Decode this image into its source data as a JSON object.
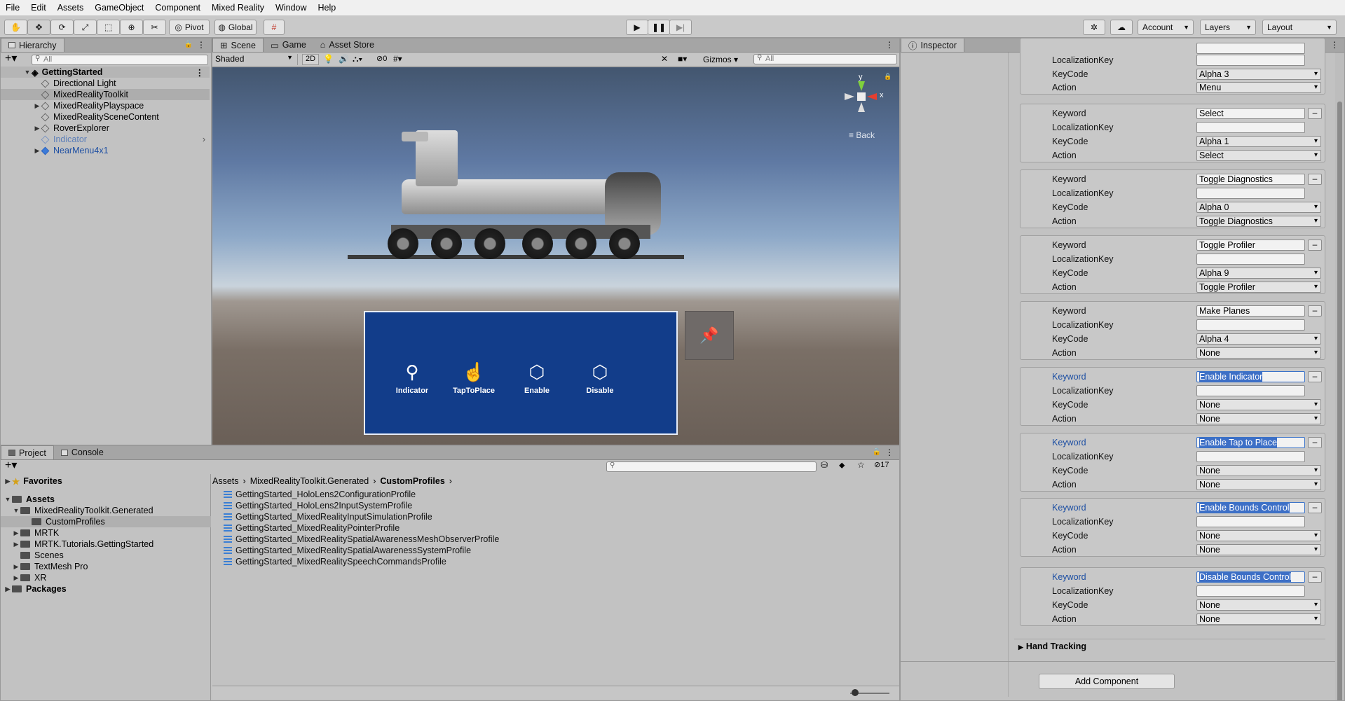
{
  "menu": [
    "File",
    "Edit",
    "Assets",
    "GameObject",
    "Component",
    "Mixed Reality",
    "Window",
    "Help"
  ],
  "toolbar": {
    "pivot": "Pivot",
    "global": "Global",
    "account": "Account",
    "layers": "Layers",
    "layout": "Layout"
  },
  "hierarchy": {
    "tab": "Hierarchy",
    "search_placeholder": "All",
    "scene": "GettingStarted",
    "items": [
      "Directional Light",
      "MixedRealityToolkit",
      "MixedRealityPlayspace",
      "MixedRealitySceneContent",
      "RoverExplorer",
      "Indicator",
      "NearMenu4x1"
    ]
  },
  "scene_view": {
    "tabs": [
      "Scene",
      "Game",
      "Asset Store"
    ],
    "shading": "Shaded",
    "mode_2d": "2D",
    "hidden_count": "0",
    "gizmos": "Gizmos",
    "search_placeholder": "All",
    "axis_y": "y",
    "axis_x": "x",
    "back": "Back",
    "menu_buttons": [
      "Indicator",
      "TapToPlace",
      "Enable",
      "Disable"
    ]
  },
  "project": {
    "tabs": [
      "Project",
      "Console"
    ],
    "favorites": "Favorites",
    "assets": "Assets",
    "tree": [
      "MixedRealityToolkit.Generated",
      "CustomProfiles",
      "MRTK",
      "MRTK.Tutorials.GettingStarted",
      "Scenes",
      "TextMesh Pro",
      "XR"
    ],
    "packages": "Packages",
    "breadcrumb": [
      "Assets",
      "MixedRealityToolkit.Generated",
      "CustomProfiles"
    ],
    "hidden_count": "17",
    "files": [
      "GettingStarted_HoloLens2ConfigurationProfile",
      "GettingStarted_HoloLens2InputSystemProfile",
      "GettingStarted_MixedRealityInputSimulationProfile",
      "GettingStarted_MixedRealityPointerProfile",
      "GettingStarted_MixedRealitySpatialAwarenessMeshObserverProfile",
      "GettingStarted_MixedRealitySpatialAwarenessSystemProfile",
      "GettingStarted_MixedRealitySpeechCommandsProfile"
    ]
  },
  "inspector": {
    "tab": "Inspector",
    "labels": {
      "keyword": "Keyword",
      "localization": "LocalizationKey",
      "keycode": "KeyCode",
      "action": "Action"
    },
    "partial": {
      "keycode": "Alpha 3",
      "action": "Menu"
    },
    "commands": [
      {
        "keyword": "Select",
        "keycode": "Alpha 1",
        "action": "Select"
      },
      {
        "keyword": "Toggle Diagnostics",
        "keycode": "Alpha 0",
        "action": "Toggle Diagnostics"
      },
      {
        "keyword": "Toggle Profiler",
        "keycode": "Alpha 9",
        "action": "Toggle Profiler"
      },
      {
        "keyword": "Make Planes",
        "keycode": "Alpha 4",
        "action": "None"
      },
      {
        "keyword": "Enable Indicator",
        "keycode": "None",
        "action": "None"
      },
      {
        "keyword": "Enable Tap to Place",
        "keycode": "None",
        "action": "None"
      },
      {
        "keyword": "Enable Bounds Control",
        "keycode": "None",
        "action": "None"
      },
      {
        "keyword": "Disable Bounds Control",
        "keycode": "None",
        "action": "None"
      }
    ],
    "hand_tracking": "Hand Tracking",
    "add_component": "Add Component"
  }
}
